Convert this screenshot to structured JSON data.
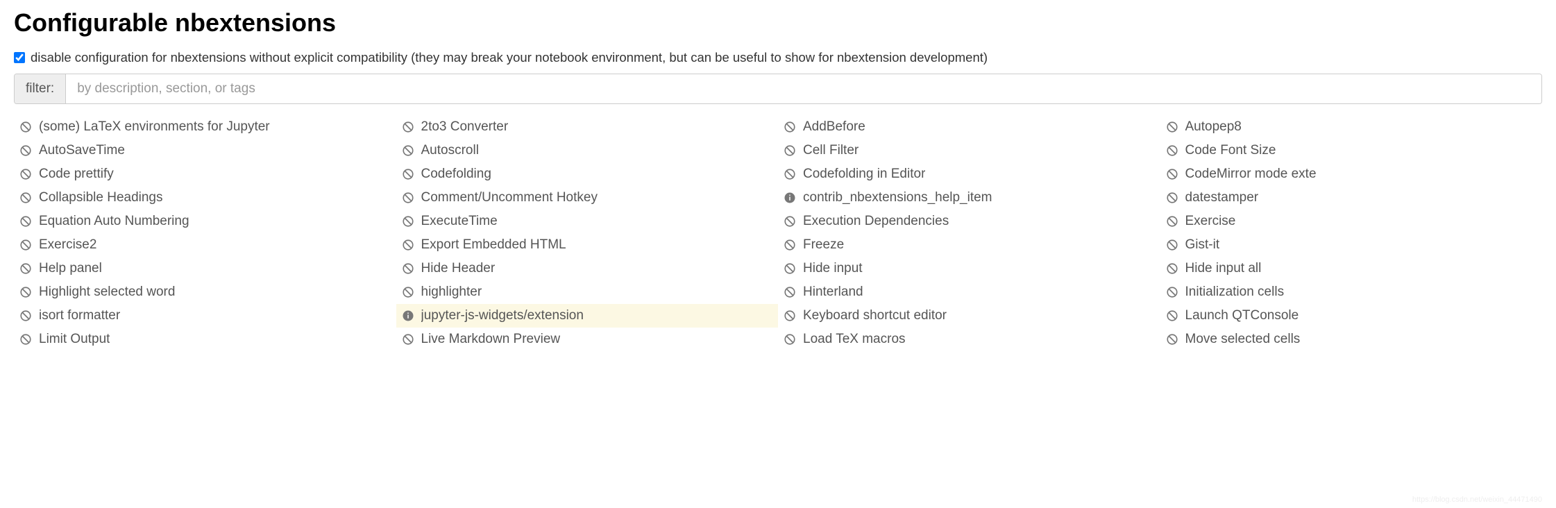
{
  "title": "Configurable nbextensions",
  "disable_label": "disable configuration for nbextensions without explicit compatibility (they may break your notebook environment, but can be useful to show for nbextension development)",
  "disable_checked": true,
  "filter": {
    "label": "filter:",
    "placeholder": "by description, section, or tags"
  },
  "colors": {
    "icon_gray": "#777",
    "highlight_bg": "#fcf8e3"
  },
  "extensions": [
    {
      "label": "(some) LaTeX environments for Jupyter",
      "icon": "ban",
      "highlight": false
    },
    {
      "label": "2to3 Converter",
      "icon": "ban",
      "highlight": false
    },
    {
      "label": "AddBefore",
      "icon": "ban",
      "highlight": false
    },
    {
      "label": "Autopep8",
      "icon": "ban",
      "highlight": false
    },
    {
      "label": "AutoSaveTime",
      "icon": "ban",
      "highlight": false
    },
    {
      "label": "Autoscroll",
      "icon": "ban",
      "highlight": false
    },
    {
      "label": "Cell Filter",
      "icon": "ban",
      "highlight": false
    },
    {
      "label": "Code Font Size",
      "icon": "ban",
      "highlight": false
    },
    {
      "label": "Code prettify",
      "icon": "ban",
      "highlight": false
    },
    {
      "label": "Codefolding",
      "icon": "ban",
      "highlight": false
    },
    {
      "label": "Codefolding in Editor",
      "icon": "ban",
      "highlight": false
    },
    {
      "label": "CodeMirror mode exte",
      "icon": "ban",
      "highlight": false
    },
    {
      "label": "Collapsible Headings",
      "icon": "ban",
      "highlight": false
    },
    {
      "label": "Comment/Uncomment Hotkey",
      "icon": "ban",
      "highlight": false
    },
    {
      "label": "contrib_nbextensions_help_item",
      "icon": "info",
      "highlight": false
    },
    {
      "label": "datestamper",
      "icon": "ban",
      "highlight": false
    },
    {
      "label": "Equation Auto Numbering",
      "icon": "ban",
      "highlight": false
    },
    {
      "label": "ExecuteTime",
      "icon": "ban",
      "highlight": false
    },
    {
      "label": "Execution Dependencies",
      "icon": "ban",
      "highlight": false
    },
    {
      "label": "Exercise",
      "icon": "ban",
      "highlight": false
    },
    {
      "label": "Exercise2",
      "icon": "ban",
      "highlight": false
    },
    {
      "label": "Export Embedded HTML",
      "icon": "ban",
      "highlight": false
    },
    {
      "label": "Freeze",
      "icon": "ban",
      "highlight": false
    },
    {
      "label": "Gist-it",
      "icon": "ban",
      "highlight": false
    },
    {
      "label": "Help panel",
      "icon": "ban",
      "highlight": false
    },
    {
      "label": "Hide Header",
      "icon": "ban",
      "highlight": false
    },
    {
      "label": "Hide input",
      "icon": "ban",
      "highlight": false
    },
    {
      "label": "Hide input all",
      "icon": "ban",
      "highlight": false
    },
    {
      "label": "Highlight selected word",
      "icon": "ban",
      "highlight": false
    },
    {
      "label": "highlighter",
      "icon": "ban",
      "highlight": false
    },
    {
      "label": "Hinterland",
      "icon": "ban",
      "highlight": false
    },
    {
      "label": "Initialization cells",
      "icon": "ban",
      "highlight": false
    },
    {
      "label": "isort formatter",
      "icon": "ban",
      "highlight": false
    },
    {
      "label": "jupyter-js-widgets/extension",
      "icon": "info",
      "highlight": true
    },
    {
      "label": "Keyboard shortcut editor",
      "icon": "ban",
      "highlight": false
    },
    {
      "label": "Launch QTConsole",
      "icon": "ban",
      "highlight": false
    },
    {
      "label": "Limit Output",
      "icon": "ban",
      "highlight": false
    },
    {
      "label": "Live Markdown Preview",
      "icon": "ban",
      "highlight": false
    },
    {
      "label": "Load TeX macros",
      "icon": "ban",
      "highlight": false
    },
    {
      "label": "Move selected cells",
      "icon": "ban",
      "highlight": false
    }
  ],
  "watermark": "https://blog.csdn.net/weixin_44471490"
}
